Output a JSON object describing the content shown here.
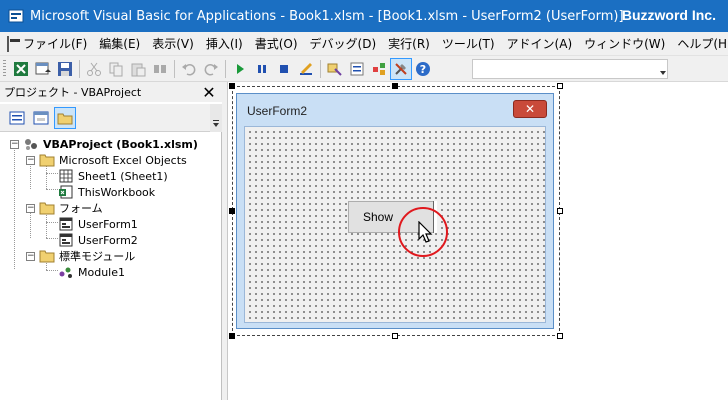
{
  "window": {
    "title": "Microsoft Visual Basic for Applications - Book1.xlsm - [Book1.xlsm - UserForm2 (UserForm)]",
    "brand": "Buzzword Inc."
  },
  "menubar": {
    "items": [
      {
        "label": "ファイル(F)"
      },
      {
        "label": "編集(E)"
      },
      {
        "label": "表示(V)"
      },
      {
        "label": "挿入(I)"
      },
      {
        "label": "書式(O)"
      },
      {
        "label": "デバッグ(D)"
      },
      {
        "label": "実行(R)"
      },
      {
        "label": "ツール(T)"
      },
      {
        "label": "アドイン(A)"
      },
      {
        "label": "ウィンドウ(W)"
      },
      {
        "label": "ヘルプ(H)"
      }
    ]
  },
  "toolbar": {
    "icons": [
      "excel-icon",
      "insert-userform-icon",
      "save-icon",
      "cut-icon",
      "copy-icon",
      "paste-icon",
      "find-icon",
      "undo-icon",
      "redo-icon",
      "run-icon",
      "break-icon",
      "reset-icon",
      "design-mode-icon",
      "project-explorer-icon",
      "properties-icon",
      "object-browser-icon",
      "toolbox-icon",
      "help-icon"
    ]
  },
  "project_panel": {
    "title": "プロジェクト - VBAProject",
    "tree": {
      "root": "VBAProject (Book1.xlsm)",
      "excel_objects_folder": "Microsoft Excel Objects",
      "sheet1": "Sheet1 (Sheet1)",
      "thisworkbook": "ThisWorkbook",
      "forms_folder": "フォーム",
      "userform1": "UserForm1",
      "userform2": "UserForm2",
      "modules_folder": "標準モジュール",
      "module1": "Module1"
    }
  },
  "designer": {
    "form_title": "UserForm2",
    "close_glyph": "✕",
    "button_label": "Show"
  },
  "colors": {
    "titlebar": "#1b6fc2",
    "highlight_circle": "#e0191e",
    "form_frame": "#c9dff5"
  }
}
